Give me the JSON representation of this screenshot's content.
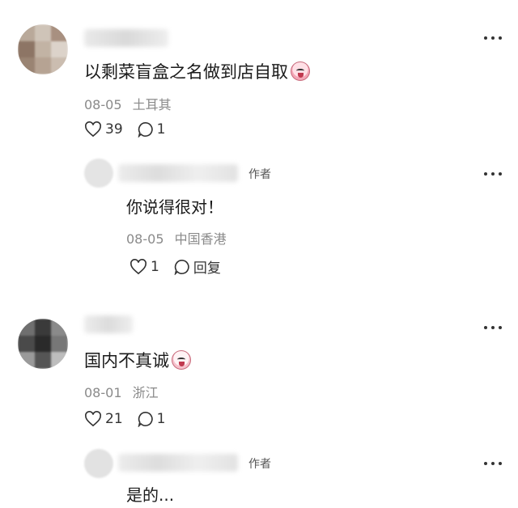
{
  "comments": [
    {
      "text": "以剩菜盲盒之名做到店自取",
      "emoji_icon": "crying-laugh-emoji-icon",
      "date": "08-05",
      "location": "土耳其",
      "likes": "39",
      "replies": "1",
      "reply": {
        "author_tag": "作者",
        "text": "你说得很对！",
        "date": "08-05",
        "location": "中国香港",
        "likes": "1",
        "reply_label": "回复"
      }
    },
    {
      "text": "国内不真诚",
      "emoji_icon": "crying-emoji-icon",
      "date": "08-01",
      "location": "浙江",
      "likes": "21",
      "replies": "1",
      "reply": {
        "author_tag": "作者",
        "text": "是的..."
      }
    }
  ],
  "icons": {
    "more": "more-dots-icon",
    "like": "heart-icon",
    "comment": "comment-bubble-icon"
  }
}
